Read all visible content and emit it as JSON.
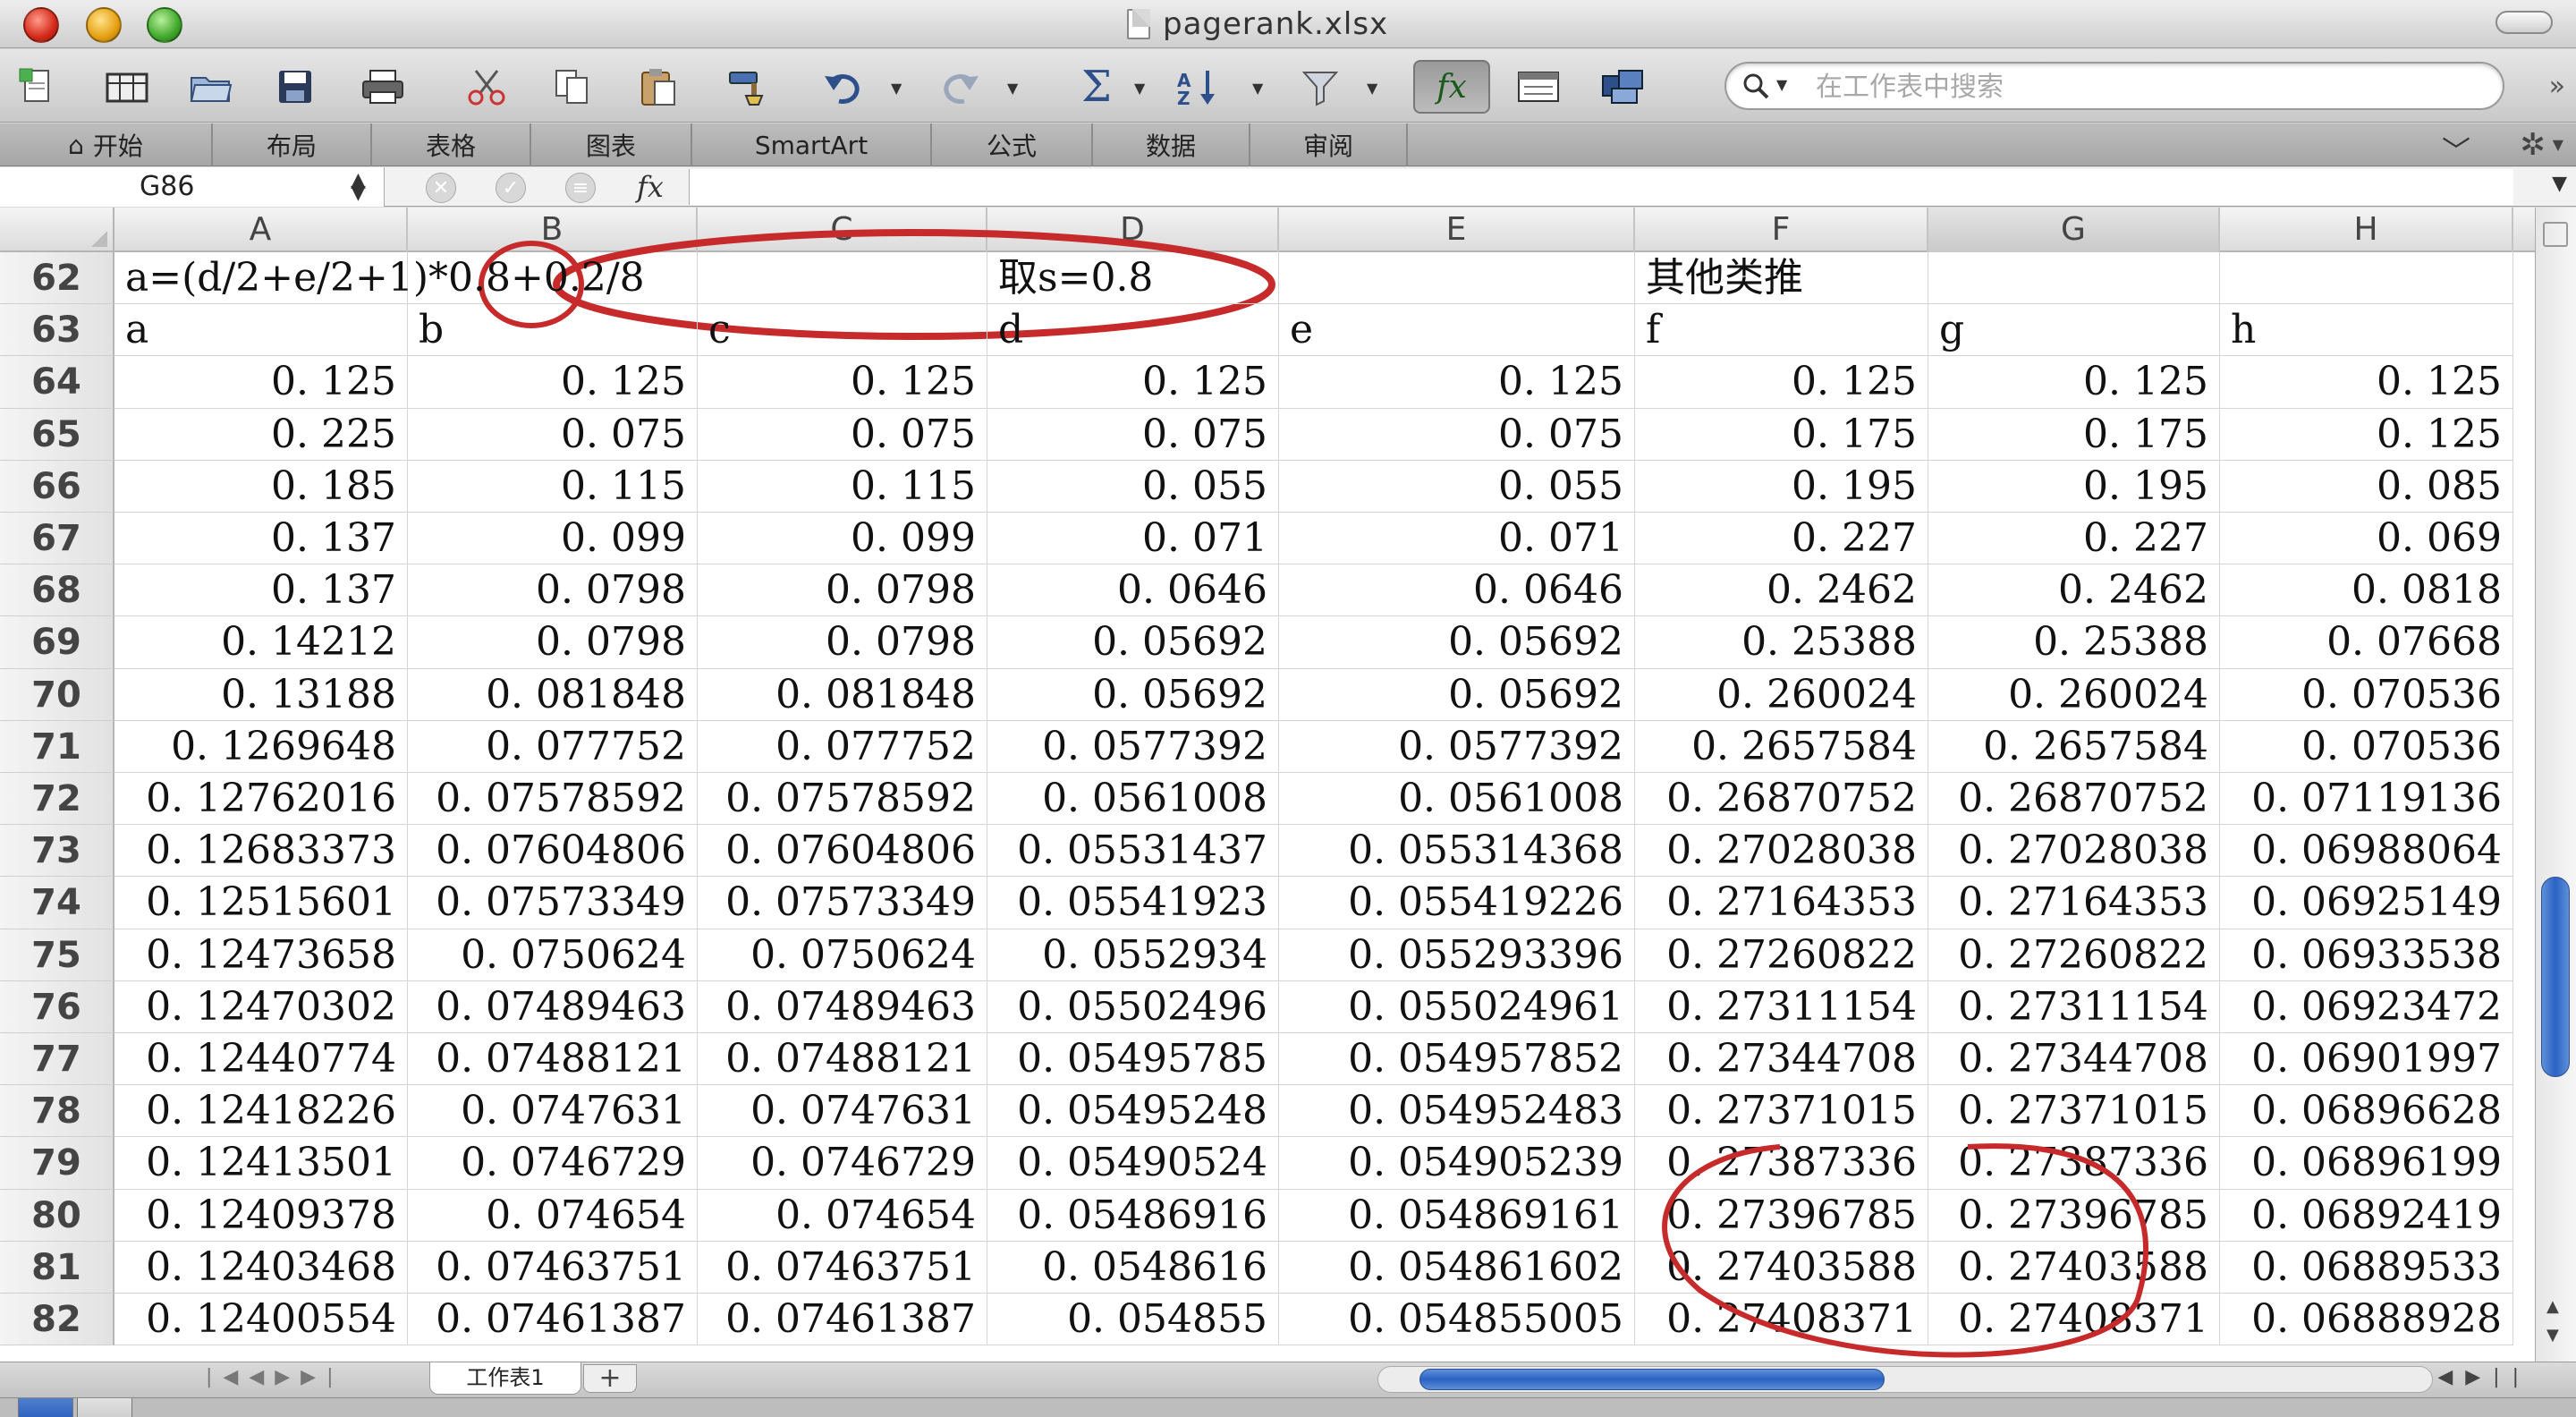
{
  "window": {
    "title": "pagerank.xlsx"
  },
  "toolbar": {
    "search_placeholder": "在工作表中搜索",
    "fx_label": "fx"
  },
  "ribbon": {
    "tabs": [
      "开始",
      "布局",
      "表格",
      "图表",
      "SmartArt",
      "公式",
      "数据",
      "审阅"
    ]
  },
  "formula_bar": {
    "name_box": "G86",
    "fx_label": "fx",
    "formula": ""
  },
  "grid": {
    "columns": [
      "A",
      "B",
      "C",
      "D",
      "E",
      "F",
      "G",
      "H"
    ],
    "selected_column": "G",
    "rows": [
      {
        "num": "62",
        "cells": [
          "a=(d/2+e/2+1)*0.8+0.2/8",
          "",
          "",
          "取s=0.8",
          "",
          "其他类推",
          "",
          ""
        ]
      },
      {
        "num": "63",
        "cells": [
          "a",
          "b",
          "c",
          "d",
          "e",
          "f",
          "g",
          "h"
        ]
      },
      {
        "num": "64",
        "cells": [
          "0. 125",
          "0. 125",
          "0. 125",
          "0. 125",
          "0. 125",
          "0. 125",
          "0. 125",
          "0. 125"
        ]
      },
      {
        "num": "65",
        "cells": [
          "0. 225",
          "0. 075",
          "0. 075",
          "0. 075",
          "0. 075",
          "0. 175",
          "0. 175",
          "0. 125"
        ]
      },
      {
        "num": "66",
        "cells": [
          "0. 185",
          "0. 115",
          "0. 115",
          "0. 055",
          "0. 055",
          "0. 195",
          "0. 195",
          "0. 085"
        ]
      },
      {
        "num": "67",
        "cells": [
          "0. 137",
          "0. 099",
          "0. 099",
          "0. 071",
          "0. 071",
          "0. 227",
          "0. 227",
          "0. 069"
        ]
      },
      {
        "num": "68",
        "cells": [
          "0. 137",
          "0. 0798",
          "0. 0798",
          "0. 0646",
          "0. 0646",
          "0. 2462",
          "0. 2462",
          "0. 0818"
        ]
      },
      {
        "num": "69",
        "cells": [
          "0. 14212",
          "0. 0798",
          "0. 0798",
          "0. 05692",
          "0. 05692",
          "0. 25388",
          "0. 25388",
          "0. 07668"
        ]
      },
      {
        "num": "70",
        "cells": [
          "0. 13188",
          "0. 081848",
          "0. 081848",
          "0. 05692",
          "0. 05692",
          "0. 260024",
          "0. 260024",
          "0. 070536"
        ]
      },
      {
        "num": "71",
        "cells": [
          "0. 1269648",
          "0. 077752",
          "0. 077752",
          "0. 0577392",
          "0. 0577392",
          "0. 2657584",
          "0. 2657584",
          "0. 070536"
        ]
      },
      {
        "num": "72",
        "cells": [
          "0. 12762016",
          "0. 07578592",
          "0. 07578592",
          "0. 0561008",
          "0. 0561008",
          "0. 26870752",
          "0. 26870752",
          "0. 07119136"
        ]
      },
      {
        "num": "73",
        "cells": [
          "0. 12683373",
          "0. 07604806",
          "0. 07604806",
          "0. 05531437",
          "0. 055314368",
          "0. 27028038",
          "0. 27028038",
          "0. 06988064"
        ]
      },
      {
        "num": "74",
        "cells": [
          "0. 12515601",
          "0. 07573349",
          "0. 07573349",
          "0. 05541923",
          "0. 055419226",
          "0. 27164353",
          "0. 27164353",
          "0. 06925149"
        ]
      },
      {
        "num": "75",
        "cells": [
          "0. 12473658",
          "0. 0750624",
          "0. 0750624",
          "0. 0552934",
          "0. 055293396",
          "0. 27260822",
          "0. 27260822",
          "0. 06933538"
        ]
      },
      {
        "num": "76",
        "cells": [
          "0. 12470302",
          "0. 07489463",
          "0. 07489463",
          "0. 05502496",
          "0. 055024961",
          "0. 27311154",
          "0. 27311154",
          "0. 06923472"
        ]
      },
      {
        "num": "77",
        "cells": [
          "0. 12440774",
          "0. 07488121",
          "0. 07488121",
          "0. 05495785",
          "0. 054957852",
          "0. 27344708",
          "0. 27344708",
          "0. 06901997"
        ]
      },
      {
        "num": "78",
        "cells": [
          "0. 12418226",
          "0. 0747631",
          "0. 0747631",
          "0. 05495248",
          "0. 054952483",
          "0. 27371015",
          "0. 27371015",
          "0. 06896628"
        ]
      },
      {
        "num": "79",
        "cells": [
          "0. 12413501",
          "0. 0746729",
          "0. 0746729",
          "0. 05490524",
          "0. 054905239",
          "0. 27387336",
          "0. 27387336",
          "0. 06896199"
        ]
      },
      {
        "num": "80",
        "cells": [
          "0. 12409378",
          "0. 074654",
          "0. 074654",
          "0. 05486916",
          "0. 054869161",
          "0. 27396785",
          "0. 27396785",
          "0. 06892419"
        ]
      },
      {
        "num": "81",
        "cells": [
          "0. 12403468",
          "0. 07463751",
          "0. 07463751",
          "0. 0548616",
          "0. 054861602",
          "0. 27403588",
          "0. 27403588",
          "0. 06889533"
        ]
      },
      {
        "num": "82",
        "cells": [
          "0. 12400554",
          "0. 07461387",
          "0. 07461387",
          "0. 054855",
          "0. 054855005",
          "0. 27408371",
          "0. 27408371",
          "0. 06888928"
        ]
      }
    ]
  },
  "sheets": {
    "tabs": [
      "工作表1"
    ],
    "add_label": "+"
  },
  "colors": {
    "annotation": "#c62a2a",
    "scroll_thumb": "#2b63c4"
  },
  "icons": [
    "new-file-icon",
    "gallery-icon",
    "open-icon",
    "save-icon",
    "print-icon",
    "cut-icon",
    "copy-icon",
    "paste-icon",
    "format-brush-icon",
    "undo-icon",
    "redo-icon",
    "autosum-icon",
    "sort-icon",
    "filter-icon",
    "fx-icon",
    "gallery-toggle-icon",
    "toolbox-icon",
    "search-icon"
  ]
}
